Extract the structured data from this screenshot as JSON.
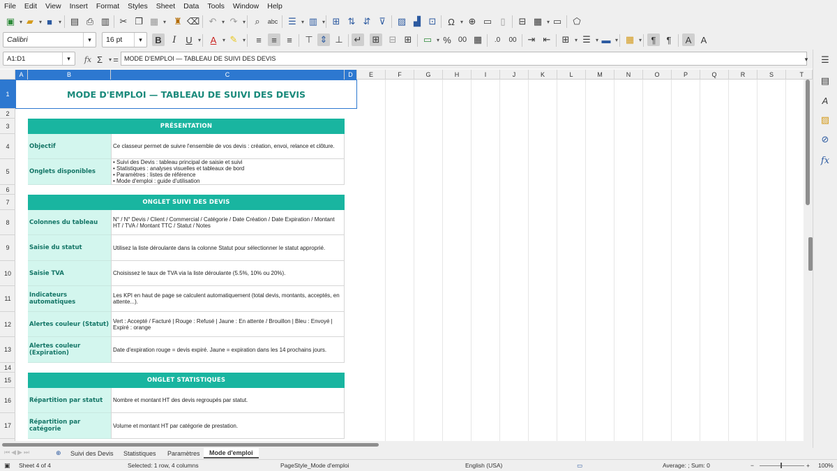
{
  "menu": [
    "File",
    "Edit",
    "View",
    "Insert",
    "Format",
    "Styles",
    "Sheet",
    "Data",
    "Tools",
    "Window",
    "Help"
  ],
  "toolbar": {
    "font_name": "Calibri",
    "font_size": "16 pt",
    "bold": "B",
    "italic": "I",
    "underline": "U",
    "percent": "%",
    "decimal_add": ".0",
    "decimal_zero": "00"
  },
  "formula_bar": {
    "name_box": "A1:D1",
    "fx": "fx",
    "sigma": "Σ",
    "equals": "=",
    "content": "MODE D'EMPLOI — TABLEAU DE SUIVI DES DEVIS"
  },
  "columns": [
    "A",
    "B",
    "C",
    "D",
    "E",
    "F",
    "G",
    "H",
    "I",
    "J",
    "K",
    "L",
    "M",
    "N",
    "O",
    "P",
    "Q",
    "R",
    "S",
    "T"
  ],
  "rows": [
    "1",
    "2",
    "3",
    "4",
    "5",
    "6",
    "7",
    "8",
    "9",
    "10",
    "11",
    "12",
    "13",
    "14",
    "15",
    "16",
    "17"
  ],
  "sheet": {
    "title": "MODE D'EMPLOI — TABLEAU DE SUIVI DES DEVIS",
    "sections": [
      {
        "header": "PRÉSENTATION",
        "rows": [
          {
            "label": "Objectif",
            "value": "Ce classeur permet de suivre l'ensemble de vos devis : création, envoi, relance et clôture."
          },
          {
            "label": "Onglets disponibles",
            "items": [
              "• Suivi des Devis : tableau principal de saisie et suivi",
              "• Statistiques : analyses visuelles et tableaux de bord",
              "• Paramètres : listes de référence",
              "• Mode d'emploi : guide d'utilisation"
            ]
          }
        ]
      },
      {
        "header": "ONGLET SUIVI DES DEVIS",
        "rows": [
          {
            "label": "Colonnes du tableau",
            "value": "N° / N° Devis / Client / Commercial / Catégorie / Date Création / Date Expiration / Montant HT / TVA / Montant TTC / Statut / Notes"
          },
          {
            "label": "Saisie du statut",
            "value": "Utilisez la liste déroulante dans la colonne Statut pour sélectionner le statut approprié."
          },
          {
            "label": "Saisie TVA",
            "value": "Choisissez le taux de TVA via la liste déroulante (5.5%, 10% ou 20%)."
          },
          {
            "label": "Indicateurs automatiques",
            "value": "Les KPI en haut de page se calculent automatiquement (total devis, montants, acceptés, en attente...)."
          },
          {
            "label": "Alertes couleur (Statut)",
            "value": "Vert : Accepté / Facturé | Rouge : Refusé | Jaune : En attente / Brouillon | Bleu : Envoyé | Expiré : orange"
          },
          {
            "label": "Alertes couleur (Expiration)",
            "value": "Date d'expiration rouge = devis expiré. Jaune = expiration dans les 14 prochains jours."
          }
        ]
      },
      {
        "header": "ONGLET STATISTIQUES",
        "rows": [
          {
            "label": "Répartition par statut",
            "value": "Nombre et montant HT des devis regroupés par statut."
          },
          {
            "label": "Répartition par catégorie",
            "value": "Volume et montant HT par catégorie de prestation."
          }
        ]
      }
    ]
  },
  "sheet_tabs": [
    "Suivi des Devis",
    "Statistiques",
    "Paramètres",
    "Mode d'emploi"
  ],
  "status": {
    "sheet": "Sheet 4 of 4",
    "selected": "Selected: 1 row, 4 columns",
    "page_style": "PageStyle_Mode d'emploi",
    "language": "English (USA)",
    "sum": "Average: ; Sum: 0",
    "zoom": "100%"
  }
}
